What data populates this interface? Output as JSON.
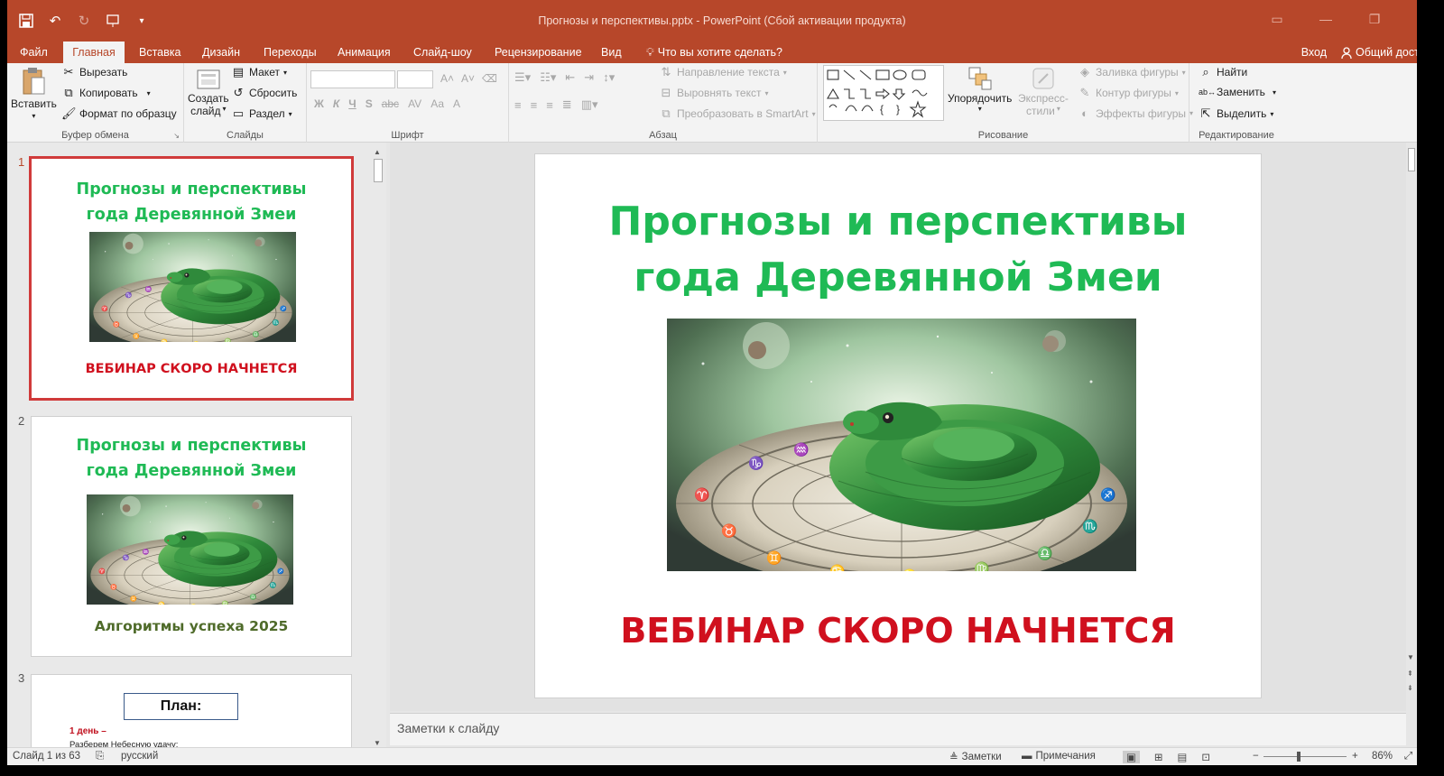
{
  "window": {
    "title": "Прогнозы и перспективы.pptx - PowerPoint (Сбой активации продукта)"
  },
  "tabs": [
    {
      "label": "Файл"
    },
    {
      "label": "Главная",
      "active": true
    },
    {
      "label": "Вставка"
    },
    {
      "label": "Дизайн"
    },
    {
      "label": "Переходы"
    },
    {
      "label": "Анимация"
    },
    {
      "label": "Слайд-шоу"
    },
    {
      "label": "Рецензирование"
    },
    {
      "label": "Вид"
    },
    {
      "label": "Что вы хотите сделать?"
    }
  ],
  "account": {
    "signin": "Вход",
    "share": "Общий доступ"
  },
  "ribbon": {
    "clipboard": {
      "label": "Буфер обмена",
      "paste": "Вставить",
      "cut": "Вырезать",
      "copy": "Копировать",
      "format_painter": "Формат по образцу"
    },
    "slides": {
      "label": "Слайды",
      "new_slide_1": "Создать",
      "new_slide_2": "слайд",
      "layout": "Макет",
      "reset": "Сбросить",
      "section": "Раздел"
    },
    "font": {
      "label": "Шрифт",
      "bold": "Ж",
      "italic": "К",
      "underline": "Ч",
      "shadow": "S",
      "strike": "abc",
      "spacing": "AV",
      "case": "Аа",
      "color": "А"
    },
    "paragraph": {
      "label": "Абзац",
      "text_direction": "Направление текста",
      "align_text": "Выровнять текст",
      "smartart": "Преобразовать в SmartArt"
    },
    "drawing": {
      "label": "Рисование",
      "arrange": "Упорядочить",
      "quick_styles_1": "Экспресс-",
      "quick_styles_2": "стили",
      "shape_fill": "Заливка фигуры",
      "shape_outline": "Контур фигуры",
      "shape_effects": "Эффекты фигуры"
    },
    "editing": {
      "label": "Редактирование",
      "find": "Найти",
      "replace": "Заменить",
      "select": "Выделить"
    }
  },
  "thumbnails": [
    {
      "num": "1",
      "title1": "Прогнозы и перспективы",
      "title2": "года Деревянной Змеи",
      "footer": "ВЕБИНАР СКОРО НАЧНЕТСЯ"
    },
    {
      "num": "2",
      "title1": "Прогнозы и перспективы",
      "title2": "года Деревянной Змеи",
      "footer": "Алгоритмы успеха 2025"
    },
    {
      "num": "3",
      "box": "План:",
      "day": "1 день –",
      "line": "Разберем Небесную удачу:"
    }
  ],
  "slide": {
    "title1": "Прогнозы и перспективы",
    "title2": "года Деревянной Змеи",
    "footer": "ВЕБИНАР СКОРО НАЧНЕТСЯ"
  },
  "notes_placeholder": "Заметки к слайду",
  "status": {
    "slide_counter": "Слайд 1 из 63",
    "language": "русский",
    "notes": "Заметки",
    "comments": "Примечания",
    "zoom": "86%"
  },
  "colors": {
    "accent": "#b7472a",
    "title_green": "#1fba55",
    "footer_red": "#d0101e",
    "subtitle_olive": "#4f6b2a"
  }
}
